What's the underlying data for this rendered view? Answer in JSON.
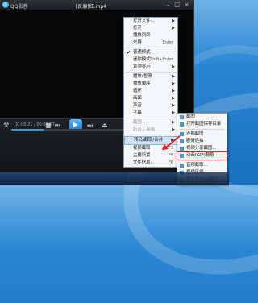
{
  "window": {
    "app_name": "QQ影音",
    "file_name": "[反腐]红.mp4"
  },
  "controls": {
    "time_display": "00:00:21 / 00:01:57",
    "progress_fraction": 0.18,
    "volume_fraction": 0.45
  },
  "context_menu": {
    "items": [
      {
        "label": "打开文件...",
        "shortcut": "",
        "submenu": true,
        "type": "item"
      },
      {
        "label": "打开",
        "shortcut": "",
        "submenu": true,
        "type": "item"
      },
      {
        "label": "播放列表",
        "shortcut": "",
        "submenu": false,
        "type": "item"
      },
      {
        "label": "全屏",
        "shortcut": "Enter",
        "submenu": false,
        "type": "item"
      },
      {
        "label": "普通模式",
        "shortcut": "",
        "submenu": false,
        "type": "check"
      },
      {
        "label": "迷你模式",
        "shortcut": "Shift+Enter",
        "submenu": false,
        "type": "item"
      },
      {
        "label": "置顶显示",
        "shortcut": "",
        "submenu": true,
        "type": "item"
      },
      {
        "label": "播放/暂停",
        "shortcut": "",
        "submenu": true,
        "type": "item"
      },
      {
        "label": "播放顺序",
        "shortcut": "",
        "submenu": true,
        "type": "item"
      },
      {
        "label": "循环",
        "shortcut": "",
        "submenu": true,
        "type": "item"
      },
      {
        "label": "画面",
        "shortcut": "",
        "submenu": true,
        "type": "item"
      },
      {
        "label": "声音",
        "shortcut": "",
        "submenu": true,
        "type": "item"
      },
      {
        "label": "字幕",
        "shortcut": "",
        "submenu": true,
        "type": "item"
      },
      {
        "label": "截图",
        "shortcut": "",
        "submenu": true,
        "type": "disabled"
      },
      {
        "label": "影音工具箱",
        "shortcut": "",
        "submenu": true,
        "type": "disabled"
      },
      {
        "label": "转码/截取/合并",
        "shortcut": "",
        "submenu": true,
        "type": "highlight"
      },
      {
        "label": "视频截取",
        "shortcut": "F3",
        "submenu": false,
        "type": "item"
      },
      {
        "label": "主要设置",
        "shortcut": "F5",
        "submenu": false,
        "type": "item"
      },
      {
        "label": "文件信息...",
        "shortcut": "F6",
        "submenu": false,
        "type": "item"
      }
    ]
  },
  "submenu": {
    "items": [
      {
        "label": "截图"
      },
      {
        "label": "打开截图保存目录"
      },
      {
        "label": "连拍截图"
      },
      {
        "label": "剧情连拍"
      },
      {
        "label": "视频分享截图..."
      },
      {
        "label": "动画(GIF)截取..."
      },
      {
        "label": "音频截取..."
      },
      {
        "label": "视频压缩..."
      },
      {
        "label": "转手机/iPad格式..."
      }
    ],
    "selected_index": 5
  },
  "colors": {
    "annotation": "#e02020",
    "menu_highlight": "#cfe3f7",
    "accent": "#3d96e0"
  }
}
